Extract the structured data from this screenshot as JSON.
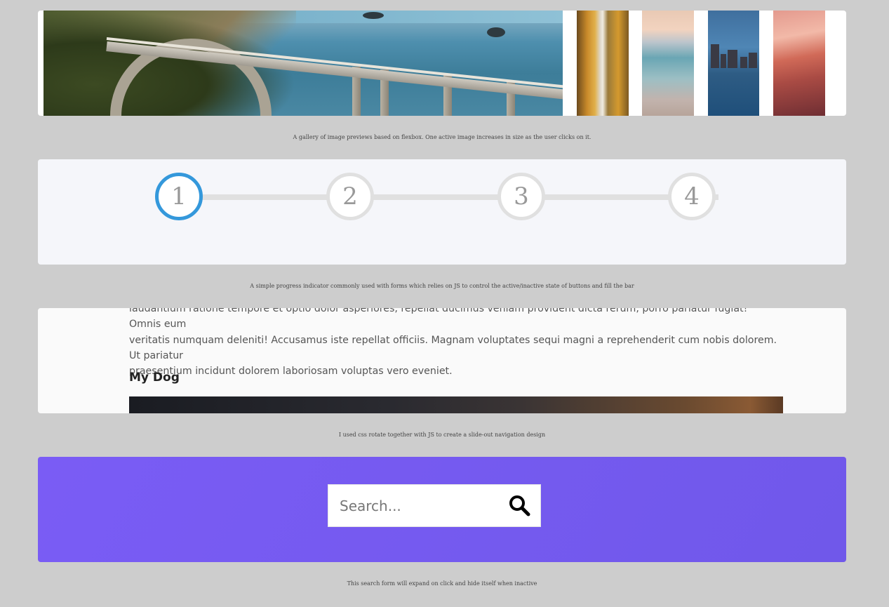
{
  "gallery": {
    "caption": "A gallery of image previews based on flexbox. One active image increases in size as the user clicks on it.",
    "images": [
      "bridge",
      "autumn-forest",
      "beach",
      "city-waterfront",
      "pink-mountain"
    ]
  },
  "progress": {
    "steps": [
      "1",
      "2",
      "3",
      "4"
    ],
    "active_step": 1,
    "active_color": "#3498db",
    "caption": "A simple progress indicator commonly used with forms which relies on JS to control the active/inactive state of buttons and fill the bar"
  },
  "article": {
    "lines": [
      "laudantium ratione tempore et optio dolor asperiores, repellat ducimus veniam provident dicta rerum, porro pariatur fugiat! Omnis eum",
      "veritatis numquam deleniti! Accusamus iste repellat officiis. Magnam voluptates sequi magni a reprehenderit cum nobis dolorem. Ut pariatur",
      "praesentium incidunt dolorem laboriosam voluptas vero eveniet."
    ],
    "heading": "My Dog",
    "caption": "I used css rotate together with JS to create a slide-out navigation design"
  },
  "search": {
    "placeholder": "Search...",
    "icon": "search-icon",
    "background_color": "#7a5cf5",
    "caption": "This search form will expand on click and hide itself when inactive"
  }
}
